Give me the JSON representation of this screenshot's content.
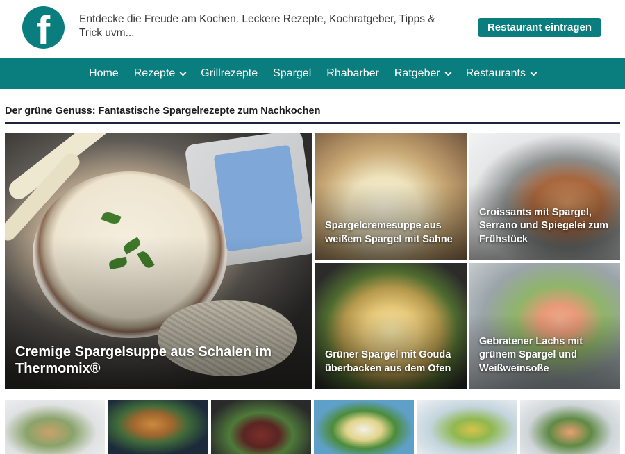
{
  "header": {
    "logo_letter": "f",
    "tagline": "Entdecke die Freude am Kochen. Leckere Rezepte, Kochratgeber, Tipps & Trick uvm...",
    "cta_label": "Restaurant eintragen"
  },
  "nav": {
    "items": [
      {
        "label": "Home",
        "dropdown": false
      },
      {
        "label": "Rezepte",
        "dropdown": true
      },
      {
        "label": "Grillrezepte",
        "dropdown": false
      },
      {
        "label": "Spargel",
        "dropdown": false
      },
      {
        "label": "Rhabarber",
        "dropdown": false
      },
      {
        "label": "Ratgeber",
        "dropdown": true
      },
      {
        "label": "Restaurants",
        "dropdown": true
      }
    ]
  },
  "section": {
    "title": "Der grüne Genuss: Fantastische Spargelrezepte zum Nachkochen"
  },
  "featured": {
    "big": {
      "title": "Cremige Spargelsuppe aus Schalen im Thermomix®"
    },
    "cards": [
      {
        "title": "Spargelcremesuppe aus weißem Spargel mit Sahne"
      },
      {
        "title": "Croissants mit Spargel, Serrano und Spiegelei zum Frühstück"
      },
      {
        "title": "Grüner Spargel mit Gouda überbacken aus dem Ofen"
      },
      {
        "title": "Gebratener Lachs mit grünem Spargel und Weißweinsoße"
      }
    ]
  },
  "colors": {
    "brand": "#0a7d7e",
    "heading_rule": "#1c2340"
  }
}
